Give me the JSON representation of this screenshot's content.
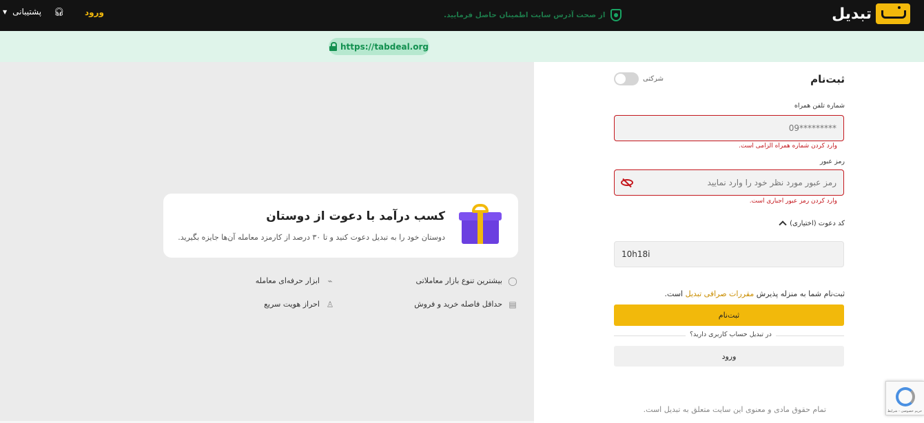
{
  "header": {
    "logo_text": "تبدیل",
    "login_label": "ورود",
    "support_label": "پشتیبانی"
  },
  "security_banner": {
    "message": "از صحت آدرس سایت اطمینان حاصل فرمایید.",
    "url": "https://tabdeal.org"
  },
  "promo": {
    "title": "کسب درآمد با دعوت از دوستان",
    "subtitle": "دوستان خود را به تبدیل دعوت کنید و تا ۳۰ درصد از کارمزد معامله آن‌ها جایزه بگیرید."
  },
  "features": [
    {
      "label": "بیشترین تنوع بازار معاملاتی",
      "icon": "coins-icon"
    },
    {
      "label": "ابزار حرفه‌ای معامله",
      "icon": "trend-icon"
    },
    {
      "label": "حداقل فاصله خرید و فروش",
      "icon": "card-icon"
    },
    {
      "label": "احراز هویت سریع",
      "icon": "user-check-icon"
    }
  ],
  "register": {
    "title": "ثبت‌نام",
    "corporate_label": "شرکتی",
    "phone_label": "شماره تلفن همراه",
    "phone_placeholder": "09*********",
    "phone_error": "وارد کردن شماره همراه الزامی است.",
    "password_label": "رمز عبور",
    "password_placeholder": "رمز عبور مورد نظر خود را وارد نمایید",
    "password_error": "وارد کردن رمز عبور اجباری است.",
    "referral_label": "کد دعوت (اختیاری)",
    "referral_value": "10h18i",
    "terms_prefix": "ثبت‌نام شما به منزله پذیرش",
    "terms_link": "مقررات صرافی تبدیل",
    "terms_suffix": "است.",
    "submit_label": "ثبت‌نام",
    "has_account_text": "در تبدیل حساب کاربری دارید؟",
    "login_label": "ورود"
  },
  "footer": {
    "copyright": "تمام حقوق مادی و معنوی این سایت متعلق به تبدیل است."
  },
  "recaptcha": {
    "text": "حریم خصوصی - شرایط"
  },
  "colors": {
    "brand": "#f2b90b",
    "error": "#c4161c",
    "secure_green": "#19a463"
  }
}
